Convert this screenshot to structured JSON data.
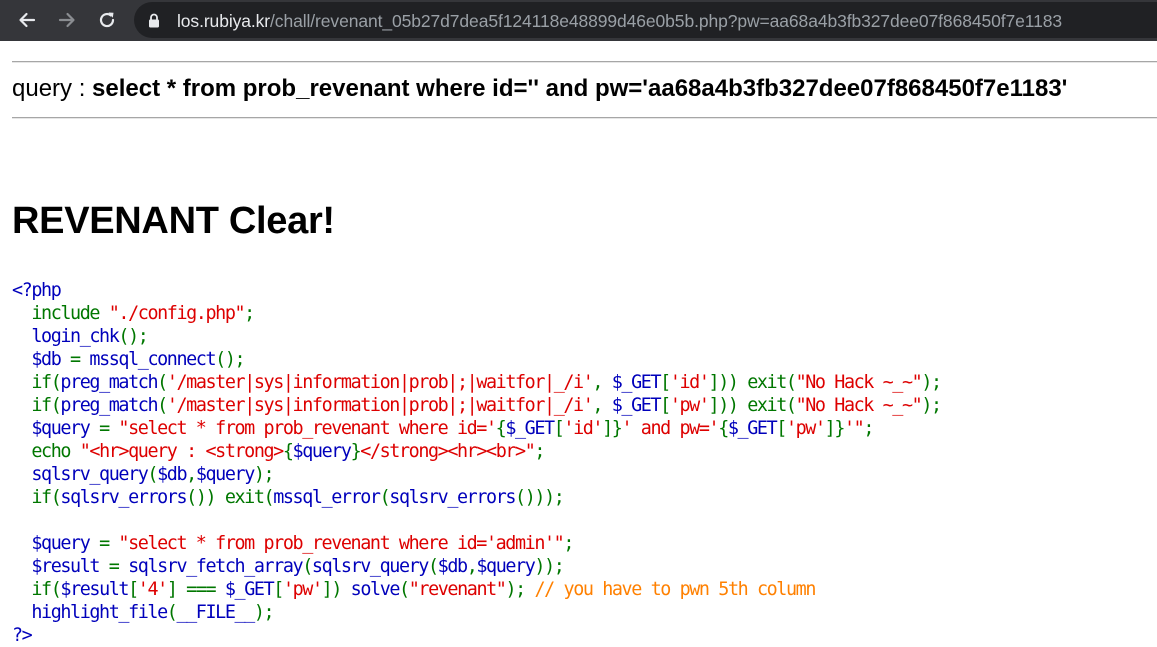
{
  "browser": {
    "url_host": "los.rubiya.kr",
    "url_path": "/chall/revenant_05b27d7dea5f124118e48899d46e0b5b.php?pw=aa68a4b3fb327dee07f868450f7e1183",
    "icons": {
      "back": "arrow-left-icon",
      "forward": "arrow-right-icon",
      "reload": "reload-icon",
      "lock": "lock-icon"
    },
    "colors": {
      "toolbar": "#35363a",
      "omnibox": "#202124"
    }
  },
  "page": {
    "query_label": "query : ",
    "query_text": "select * from prob_revenant where id='' and pw='aa68a4b3fb327dee07f868450f7e1183'",
    "clear_title": "REVENANT Clear!"
  },
  "source_colors": {
    "html": "#000000",
    "default": "#0000BB",
    "keyword": "#007700",
    "string": "#DD0000",
    "comment": "#FF8000"
  },
  "source_lines": [
    [
      [
        "default",
        "<?php"
      ]
    ],
    [
      [
        "default",
        "  "
      ],
      [
        "keyword",
        "include "
      ],
      [
        "string",
        "\"./config.php\""
      ],
      [
        "keyword",
        ";"
      ]
    ],
    [
      [
        "default",
        "  login_chk"
      ],
      [
        "keyword",
        "();"
      ]
    ],
    [
      [
        "default",
        "  $db "
      ],
      [
        "keyword",
        "= "
      ],
      [
        "default",
        "mssql_connect"
      ],
      [
        "keyword",
        "();"
      ]
    ],
    [
      [
        "default",
        "  "
      ],
      [
        "keyword",
        "if("
      ],
      [
        "default",
        "preg_match"
      ],
      [
        "keyword",
        "("
      ],
      [
        "string",
        "'/master|sys|information|prob|;|waitfor|_/i'"
      ],
      [
        "keyword",
        ", "
      ],
      [
        "default",
        "$_GET"
      ],
      [
        "keyword",
        "["
      ],
      [
        "string",
        "'id'"
      ],
      [
        "keyword",
        "])) exit("
      ],
      [
        "string",
        "\"No Hack ~_~\""
      ],
      [
        "keyword",
        ");"
      ]
    ],
    [
      [
        "default",
        "  "
      ],
      [
        "keyword",
        "if("
      ],
      [
        "default",
        "preg_match"
      ],
      [
        "keyword",
        "("
      ],
      [
        "string",
        "'/master|sys|information|prob|;|waitfor|_/i'"
      ],
      [
        "keyword",
        ", "
      ],
      [
        "default",
        "$_GET"
      ],
      [
        "keyword",
        "["
      ],
      [
        "string",
        "'pw'"
      ],
      [
        "keyword",
        "])) exit("
      ],
      [
        "string",
        "\"No Hack ~_~\""
      ],
      [
        "keyword",
        ");"
      ]
    ],
    [
      [
        "default",
        "  $query "
      ],
      [
        "keyword",
        "= "
      ],
      [
        "string",
        "\"select * from prob_revenant where id='"
      ],
      [
        "keyword",
        "{"
      ],
      [
        "default",
        "$_GET"
      ],
      [
        "keyword",
        "["
      ],
      [
        "string",
        "'id'"
      ],
      [
        "keyword",
        "]}"
      ],
      [
        "string",
        "' and pw='"
      ],
      [
        "keyword",
        "{"
      ],
      [
        "default",
        "$_GET"
      ],
      [
        "keyword",
        "["
      ],
      [
        "string",
        "'pw'"
      ],
      [
        "keyword",
        "]}"
      ],
      [
        "string",
        "'\""
      ],
      [
        "keyword",
        ";"
      ]
    ],
    [
      [
        "default",
        "  "
      ],
      [
        "keyword",
        "echo "
      ],
      [
        "string",
        "\"<hr>query : <strong>"
      ],
      [
        "keyword",
        "{"
      ],
      [
        "default",
        "$query"
      ],
      [
        "keyword",
        "}"
      ],
      [
        "string",
        "</strong><hr><br>\""
      ],
      [
        "keyword",
        ";"
      ]
    ],
    [
      [
        "default",
        "  sqlsrv_query"
      ],
      [
        "keyword",
        "("
      ],
      [
        "default",
        "$db"
      ],
      [
        "keyword",
        ","
      ],
      [
        "default",
        "$query"
      ],
      [
        "keyword",
        ");"
      ]
    ],
    [
      [
        "default",
        "  "
      ],
      [
        "keyword",
        "if("
      ],
      [
        "default",
        "sqlsrv_errors"
      ],
      [
        "keyword",
        "()) exit("
      ],
      [
        "default",
        "mssql_error"
      ],
      [
        "keyword",
        "("
      ],
      [
        "default",
        "sqlsrv_errors"
      ],
      [
        "keyword",
        "()));"
      ]
    ],
    [
      [
        "default",
        ""
      ]
    ],
    [
      [
        "default",
        "  $query "
      ],
      [
        "keyword",
        "= "
      ],
      [
        "string",
        "\"select * from prob_revenant where id='admin'\""
      ],
      [
        "keyword",
        ";"
      ]
    ],
    [
      [
        "default",
        "  $result "
      ],
      [
        "keyword",
        "= "
      ],
      [
        "default",
        "sqlsrv_fetch_array"
      ],
      [
        "keyword",
        "("
      ],
      [
        "default",
        "sqlsrv_query"
      ],
      [
        "keyword",
        "("
      ],
      [
        "default",
        "$db"
      ],
      [
        "keyword",
        ","
      ],
      [
        "default",
        "$query"
      ],
      [
        "keyword",
        "));"
      ]
    ],
    [
      [
        "default",
        "  "
      ],
      [
        "keyword",
        "if("
      ],
      [
        "default",
        "$result"
      ],
      [
        "keyword",
        "["
      ],
      [
        "string",
        "'4'"
      ],
      [
        "keyword",
        "] === "
      ],
      [
        "default",
        "$_GET"
      ],
      [
        "keyword",
        "["
      ],
      [
        "string",
        "'pw'"
      ],
      [
        "keyword",
        "]) "
      ],
      [
        "default",
        "solve"
      ],
      [
        "keyword",
        "("
      ],
      [
        "string",
        "\"revenant\""
      ],
      [
        "keyword",
        "); "
      ],
      [
        "comment",
        "// you have to pwn 5th column"
      ]
    ],
    [
      [
        "default",
        "  highlight_file"
      ],
      [
        "keyword",
        "("
      ],
      [
        "default",
        "__FILE__"
      ],
      [
        "keyword",
        ");"
      ]
    ],
    [
      [
        "default",
        "?>"
      ]
    ]
  ]
}
